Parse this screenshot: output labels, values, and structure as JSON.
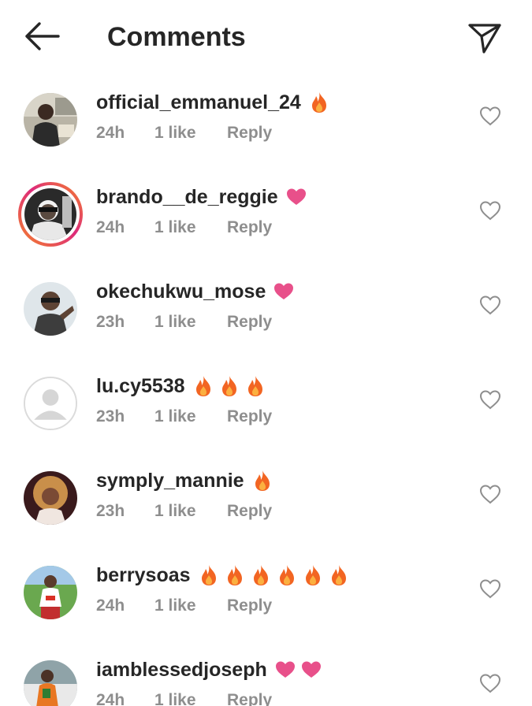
{
  "header": {
    "title": "Comments",
    "back_icon": "arrow-left-icon",
    "send_icon": "paper-plane-icon"
  },
  "colors": {
    "text": "#262626",
    "meta": "#8e8e8e",
    "heart_emoji": "#e8508a",
    "fire_emoji": "#f26522",
    "story_ring": "#dd2a7b"
  },
  "comments": [
    {
      "username": "official_emmanuel_24",
      "emojis": [
        "fire"
      ],
      "time": "24h",
      "likes": "1 like",
      "reply": "Reply",
      "avatar": "photo"
    },
    {
      "username": "brando__de_reggie",
      "emojis": [
        "heart"
      ],
      "time": "24h",
      "likes": "1 like",
      "reply": "Reply",
      "avatar": "photo-story"
    },
    {
      "username": "okechukwu_mose",
      "emojis": [
        "heart"
      ],
      "time": "23h",
      "likes": "1 like",
      "reply": "Reply",
      "avatar": "photo"
    },
    {
      "username": "lu.cy5538",
      "emojis": [
        "fire",
        "fire",
        "fire"
      ],
      "time": "23h",
      "likes": "1 like",
      "reply": "Reply",
      "avatar": "default"
    },
    {
      "username": "symply_mannie",
      "emojis": [
        "fire"
      ],
      "time": "23h",
      "likes": "1 like",
      "reply": "Reply",
      "avatar": "photo"
    },
    {
      "username": "berrysoas",
      "emojis": [
        "fire",
        "fire",
        "fire",
        "fire",
        "fire",
        "fire"
      ],
      "time": "24h",
      "likes": "1 like",
      "reply": "Reply",
      "avatar": "photo"
    },
    {
      "username": "iamblessedjoseph",
      "emojis": [
        "heart",
        "heart"
      ],
      "time": "24h",
      "likes": "1 like",
      "reply": "Reply",
      "avatar": "photo"
    }
  ]
}
